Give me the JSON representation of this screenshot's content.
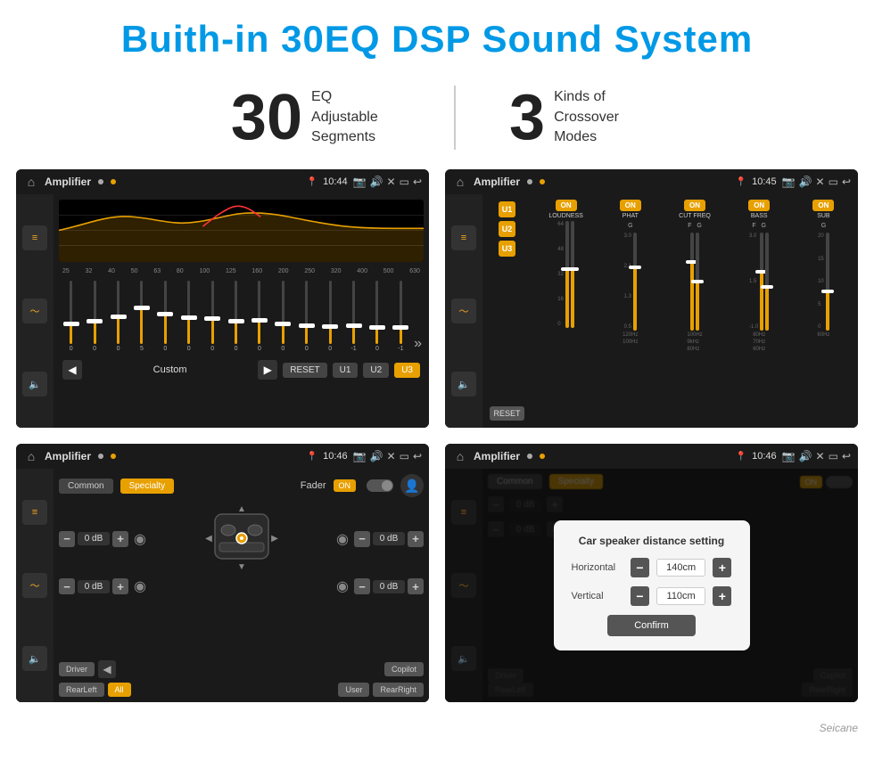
{
  "header": {
    "title": "Buith-in 30EQ DSP Sound System"
  },
  "stats": [
    {
      "number": "30",
      "desc_line1": "EQ Adjustable",
      "desc_line2": "Segments"
    },
    {
      "number": "3",
      "desc_line1": "Kinds of",
      "desc_line2": "Crossover Modes"
    }
  ],
  "screens": [
    {
      "id": "screen1",
      "title": "Amplifier",
      "time": "10:44",
      "type": "eq",
      "freq_labels": [
        "25",
        "32",
        "40",
        "50",
        "63",
        "80",
        "100",
        "125",
        "160",
        "200",
        "250",
        "320",
        "400",
        "500",
        "630"
      ],
      "sliders": [
        0,
        2,
        4,
        6,
        5,
        4,
        3,
        2,
        3,
        4,
        3,
        2,
        1,
        1,
        0
      ],
      "bottom_btns": [
        "Custom",
        "RESET",
        "U1",
        "U2",
        "U3"
      ]
    },
    {
      "id": "screen2",
      "title": "Amplifier",
      "time": "10:45",
      "type": "crossover",
      "presets": [
        "U1",
        "U2",
        "U3"
      ],
      "channels": [
        {
          "name": "LOUDNESS",
          "on": true
        },
        {
          "name": "PHAT",
          "on": true
        },
        {
          "name": "CUT FREQ",
          "on": true
        },
        {
          "name": "BASS",
          "on": true
        },
        {
          "name": "SUB",
          "on": true
        }
      ]
    },
    {
      "id": "screen3",
      "title": "Amplifier",
      "time": "10:46",
      "type": "fader",
      "tabs": [
        "Common",
        "Specialty"
      ],
      "fader_label": "Fader",
      "fader_on": "ON",
      "controls": [
        {
          "label": "0 dB",
          "side": "left"
        },
        {
          "label": "0 dB",
          "side": "left"
        },
        {
          "label": "0 dB",
          "side": "right"
        },
        {
          "label": "0 dB",
          "side": "right"
        }
      ],
      "bottom_btns": [
        "Driver",
        "RearLeft",
        "All",
        "User",
        "RearRight",
        "Copilot"
      ]
    },
    {
      "id": "screen4",
      "title": "Amplifier",
      "time": "10:46",
      "type": "distance",
      "modal": {
        "title": "Car speaker distance setting",
        "horizontal_label": "Horizontal",
        "horizontal_value": "140cm",
        "vertical_label": "Vertical",
        "vertical_value": "110cm",
        "confirm_label": "Confirm"
      },
      "bottom_btns": [
        "Driver",
        "RearLeft",
        "All",
        "User",
        "RearRight",
        "Copilot"
      ]
    }
  ],
  "watermark": "Seicane"
}
